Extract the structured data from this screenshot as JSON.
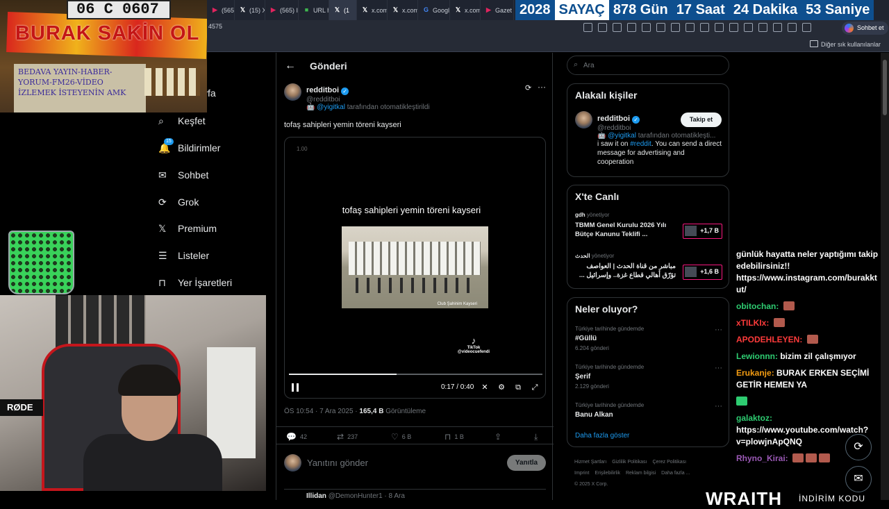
{
  "browser": {
    "tabs": [
      {
        "label": "(565)",
        "fav": "youtube-icon",
        "color": "#e0245e"
      },
      {
        "label": "(15) X",
        "fav": "x-icon",
        "color": "#ffffff"
      },
      {
        "label": "(565) I",
        "fav": "youtube-icon",
        "color": "#e0245e"
      },
      {
        "label": "URL h",
        "fav": "url-icon",
        "color": "#3fb950"
      },
      {
        "label": "(1",
        "fav": "x-icon",
        "color": "#ffffff"
      },
      {
        "label": "x.com",
        "fav": "x-icon",
        "color": "#ffffff"
      },
      {
        "label": "x.com",
        "fav": "x-icon",
        "color": "#ffffff"
      },
      {
        "label": "Googl",
        "fav": "google-icon",
        "color": "#4285f4"
      },
      {
        "label": "x.com",
        "fav": "x-icon",
        "color": "#ffffff"
      },
      {
        "label": "Gazet",
        "fav": "youtube-icon",
        "color": "#e0245e"
      }
    ],
    "address": "4575",
    "sohbet_label": "Sohbet et",
    "other_bookmarks": "Diğer sık kullanılanlar"
  },
  "counter": {
    "year": "2028",
    "label": "SAYAÇ",
    "days": "878 Gün",
    "hours": "17 Saat",
    "minutes": "24 Dakika",
    "seconds": "53 Saniye"
  },
  "stream": {
    "plate": "06 C 0607",
    "banner": "BURAK SAKİN OL",
    "sign": "BEDAVA YAYIN-HABER-YORUM-FM26-VİDEO İZLEMEK İSTEYENİN AMK",
    "mic_brand": "RØDE",
    "sponsor": "WRAITH",
    "sponsor_sub": "İNDİRİM KODU"
  },
  "nav": {
    "home_partial": "yfa",
    "items": [
      {
        "label": "Keşfet",
        "icon": "search-icon"
      },
      {
        "label": "Bildirimler",
        "icon": "bell-icon",
        "badge": "15"
      },
      {
        "label": "Sohbet",
        "icon": "mail-icon"
      },
      {
        "label": "Grok",
        "icon": "grok-icon"
      },
      {
        "label": "Premium",
        "icon": "x-icon"
      },
      {
        "label": "Listeler",
        "icon": "list-icon"
      },
      {
        "label": "Yer İşaretleri",
        "icon": "bookmark-icon"
      }
    ]
  },
  "post": {
    "header": "Gönderi",
    "author": "redditboi",
    "handle": "@redditboi",
    "auto_by": "@yigitkal",
    "auto_suffix": "tarafından otomatikleştirildi",
    "text": "tofaş sahipleri yemin töreni kayseri",
    "video": {
      "top_time": "1.00",
      "caption": "tofaş sahipleri yemin töreni kayseri",
      "watermark": "Club Şahinim Kayseri",
      "tiktok": "TikTok",
      "tiktok_user": "@videocuefendi",
      "current": "0:17",
      "duration": "0:40",
      "time_display": "0:17 / 0:40",
      "progress": 0.425
    },
    "timestamp": "ÖS 10:54 · 7 Ara 2025 · ",
    "views": "165,4 B",
    "views_label": " Görüntüleme",
    "stats": {
      "replies": "42",
      "reposts": "237",
      "likes": "6 B",
      "bookmarks": "1 B"
    },
    "reply_placeholder": "Yanıtını gönder",
    "reply_button": "Yanıtla",
    "next_author": "Illidan",
    "next_meta": "@DemonHunter1 · 8 Ara"
  },
  "sidebar": {
    "search_placeholder": "Ara",
    "related": {
      "title": "Alakalı kişiler",
      "name": "redditboi",
      "handle": "@redditboi",
      "auto_by": "@yigitkal",
      "auto_suffix": "tarafından otomatikleşti...",
      "follow": "Takip et",
      "bio_prefix": "i saw it on ",
      "bio_link": "#reddit",
      "bio_suffix": ". You can send a direct message for advertising and cooperation"
    },
    "live": {
      "title": "X'te Canlı",
      "items": [
        {
          "host": "gdh",
          "status": "yönetiyor",
          "title": "TBMM Genel Kurulu 2026 Yılı Bütçe Kanunu Teklifi ...",
          "listeners": "+1,7 B"
        },
        {
          "host": "الحدث",
          "status": "yönetiyor",
          "title": "مباشر من قناة الحدث | العواصف تؤرّق أهالي قطاع غزة.. وإسرائيل ...",
          "listeners": "+1,6 B"
        }
      ]
    },
    "trends": {
      "title": "Neler oluyor?",
      "items": [
        {
          "category": "Türkiye tarihinde gündemde",
          "name": "#Güllü",
          "count": "6.204 gönderi"
        },
        {
          "category": "Türkiye tarihinde gündemde",
          "name": "Şerif",
          "count": "2.129 gönderi"
        },
        {
          "category": "Türkiye tarihinde gündemde",
          "name": "Banu Alkan",
          "count": ""
        }
      ],
      "more": "Daha fazla göster"
    },
    "footer": [
      "Hizmet Şartları",
      "Gizlilik Politikası",
      "Çerez Politikası",
      "Imprint",
      "Erişilebilirlik",
      "Reklam bilgisi",
      "Daha fazla ...",
      "© 2025 X Corp."
    ]
  },
  "chat": [
    {
      "user": "",
      "text": "günlük hayatta neler yaptığımı takip edebilirsiniz!! https://www.instagram.com/burakktut/",
      "color": "#ffffff"
    },
    {
      "user": "obitochan:",
      "text": "",
      "color": "#2ecc71",
      "emote": true
    },
    {
      "user": "xTILKIx:",
      "text": "",
      "color": "#ff3b3b",
      "emote": true
    },
    {
      "user": "APODEHLEYEN:",
      "text": "",
      "color": "#ff3b3b",
      "emote": true
    },
    {
      "user": "Lewionnn:",
      "text": "bizim zil çalışmıyor",
      "color": "#2ecc71"
    },
    {
      "user": "Erukanje:",
      "text": "BURAK ERKEN SEÇİMİ GETİR HEMEN YA",
      "color": "#f39c12"
    },
    {
      "user": "",
      "text": "",
      "color": "#2ecc71"
    },
    {
      "user": "galaktoz:",
      "text": "https://www.youtube.com/watch?v=plowjnApQNQ",
      "color": "#2ecc71"
    },
    {
      "user": "Rhyno_Kirai:",
      "text": "",
      "color": "#9b59b6",
      "emote": true
    }
  ]
}
